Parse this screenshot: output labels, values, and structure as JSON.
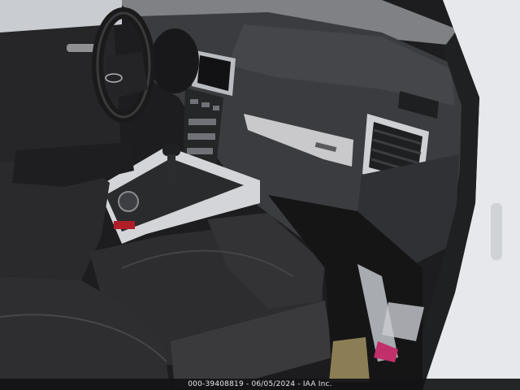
{
  "photo": {
    "subject": "car-interior-passenger-view",
    "caption": "000-39408819 - 06/05/2024 - IAA Inc.",
    "colors": {
      "dash": "#3a3b3e",
      "dash_dark": "#232427",
      "leather": "#2b2b2d",
      "trim": "#c8c8c8",
      "exterior": "#e9ebee",
      "floor": "#141415"
    }
  }
}
